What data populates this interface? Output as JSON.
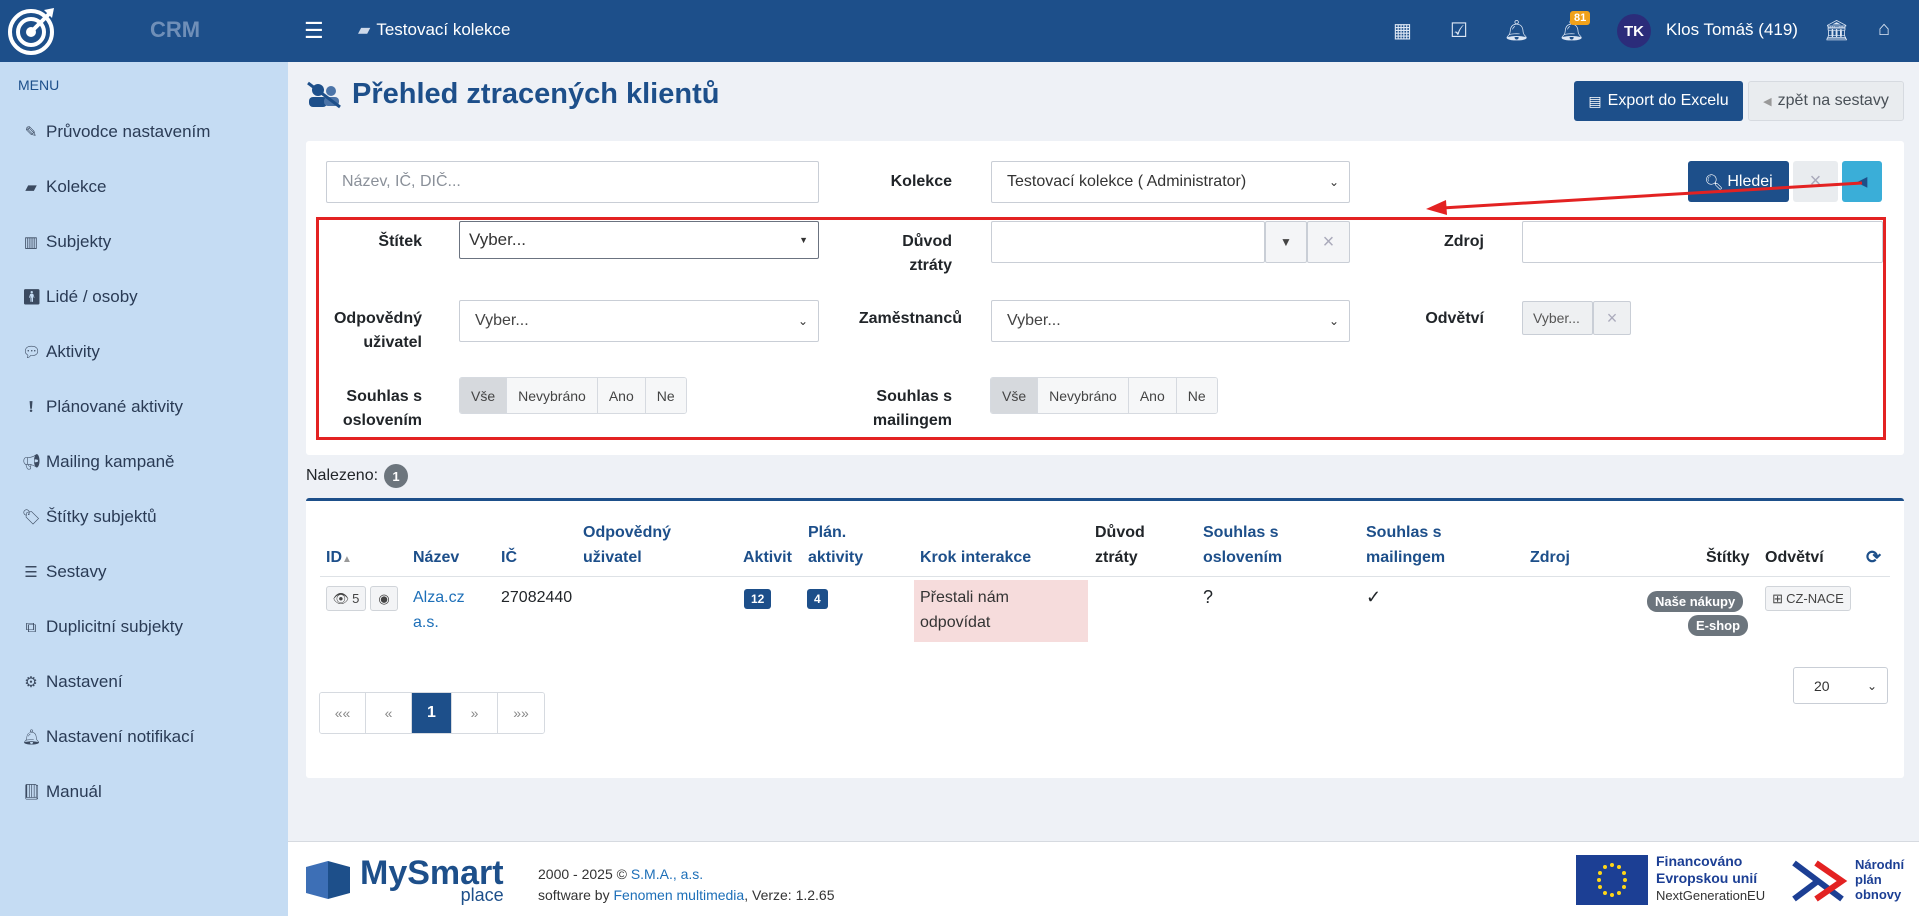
{
  "app": {
    "brand": "CRM",
    "collection_title": "Testovací kolekce",
    "user_initials": "TK",
    "user_name": "Klos Tomáš (419)",
    "notif_count": "81"
  },
  "sidebar": {
    "menu_label": "MENU",
    "items": [
      {
        "label": "Průvodce nastavením",
        "icon": "pencil-icon"
      },
      {
        "label": "Kolekce",
        "icon": "collection-icon"
      },
      {
        "label": "Subjekty",
        "icon": "building-icon"
      },
      {
        "label": "Lidé / osoby",
        "icon": "person-icon"
      },
      {
        "label": "Aktivity",
        "icon": "comments-icon"
      },
      {
        "label": "Plánované aktivity",
        "icon": "alert-icon"
      },
      {
        "label": "Mailing kampaně",
        "icon": "megaphone-icon"
      },
      {
        "label": "Štítky subjektů",
        "icon": "tag-icon"
      },
      {
        "label": "Sestavy",
        "icon": "list-icon"
      },
      {
        "label": "Duplicitní subjekty",
        "icon": "duplicate-icon"
      },
      {
        "label": "Nastavení",
        "icon": "gears-icon"
      },
      {
        "label": "Nastavení notifikací",
        "icon": "bell-icon"
      },
      {
        "label": "Manuál",
        "icon": "book-icon"
      }
    ]
  },
  "page": {
    "title": "Přehled ztracených klientů",
    "export_label": "Export do Excelu",
    "back_label": "zpět na sestavy"
  },
  "filters": {
    "search_placeholder": "Název, IČ, DIČ...",
    "kolekce_label": "Kolekce",
    "kolekce_value": "Testovací kolekce ( Administrator)",
    "search_button": "Hledej",
    "stitek_label": "Štítek",
    "stitek_value": "Vyber...",
    "duvod_label_1": "Důvod",
    "duvod_label_2": "ztráty",
    "zdroj_label": "Zdroj",
    "odpovedny_label_1": "Odpovědný",
    "odpovedny_label_2": "uživatel",
    "odpovedny_value": "Vyber...",
    "zamestnancu_label": "Zaměstnanců",
    "zamestnancu_value": "Vyber...",
    "odvetvi_label": "Odvětví",
    "odvetvi_value": "Vyber...",
    "souhlas_osl_label_1": "Souhlas s",
    "souhlas_osl_label_2": "oslovením",
    "souhlas_mail_label_1": "Souhlas s",
    "souhlas_mail_label_2": "mailingem",
    "seg_options": [
      "Vše",
      "Nevybráno",
      "Ano",
      "Ne"
    ]
  },
  "results": {
    "found_label": "Nalezeno:",
    "found_count": "1"
  },
  "table": {
    "headers": {
      "id": "ID",
      "nazev": "Název",
      "ic": "IČ",
      "odpovedny_1": "Odpovědný",
      "odpovedny_2": "uživatel",
      "aktivit": "Aktivit",
      "plan_1": "Plán.",
      "plan_2": "aktivity",
      "krok": "Krok interakce",
      "duvod_1": "Důvod",
      "duvod_2": "ztráty",
      "sosl_1": "Souhlas s",
      "sosl_2": "oslovením",
      "smail_1": "Souhlas s",
      "smail_2": "mailingem",
      "zdroj": "Zdroj",
      "stitky": "Štítky",
      "odvetvi": "Odvětví"
    },
    "row": {
      "views": "5",
      "nazev_1": "Alza.cz",
      "nazev_2": "a.s.",
      "ic": "27082440",
      "aktivit": "12",
      "plan": "4",
      "krok_1": "Přestali nám",
      "krok_2": "odpovídat",
      "souhlas_osl": "?",
      "souhlas_mail": "✓",
      "tags": [
        "Naše nákupy",
        "E-shop"
      ],
      "odvetvi": "CZ-NACE"
    }
  },
  "pager": {
    "first": "««",
    "prev": "«",
    "current": "1",
    "next": "»",
    "last": "»»",
    "per_page": "20"
  },
  "footer": {
    "brand_1": "MySmart",
    "brand_2": "place",
    "line1_prefix": "2000 - 2025 © ",
    "line1_link": "S.M.A., a.s.",
    "line2_prefix": "software by ",
    "line2_link": "Fenomen multimedia",
    "line2_suffix": ", Verze: 1.2.65",
    "eu_1": "Financováno",
    "eu_2": "Evropskou unií",
    "eu_3": "NextGenerationEU",
    "npo_1": "Národní",
    "npo_2": "plán",
    "npo_3": "obnovy"
  }
}
